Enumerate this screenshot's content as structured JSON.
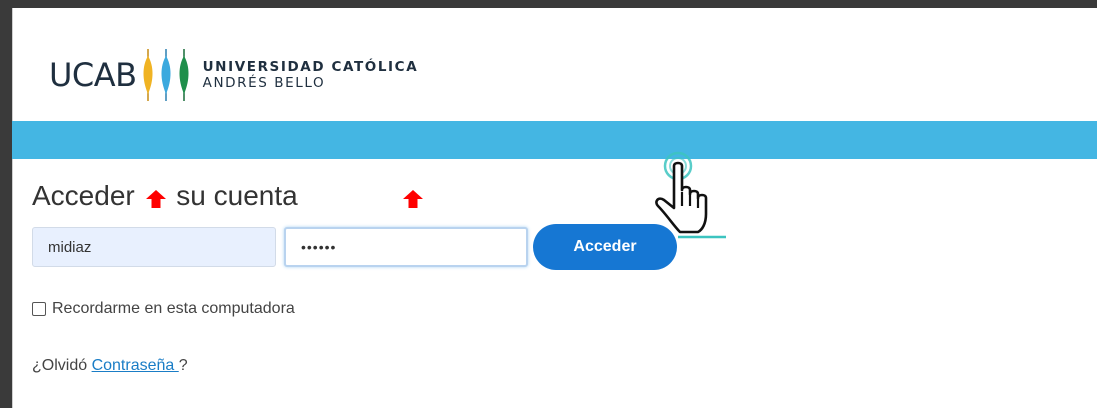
{
  "logo": {
    "short": "UCAB",
    "name_line1": "UNIVERSIDAD CATÓLICA",
    "name_line2": "ANDRÉS BELLO",
    "colors": [
      "#f0b323",
      "#3ba9de",
      "#1f8f4b"
    ]
  },
  "band_color": "#44b6e3",
  "login": {
    "heading_part1": "Acceder",
    "heading_part2": "su cuenta",
    "username_value": "midiaz",
    "password_value": "••••••",
    "submit_label": "Acceder",
    "remember_label": "Recordarme en esta computadora",
    "remember_checked": false,
    "forgot_prefix": "¿Olvidó ",
    "forgot_link": "Contraseña ",
    "forgot_suffix": "?"
  },
  "annotations": {
    "arrow_color": "#ff0000",
    "cursor_icon": "hand-pointer-icon"
  }
}
